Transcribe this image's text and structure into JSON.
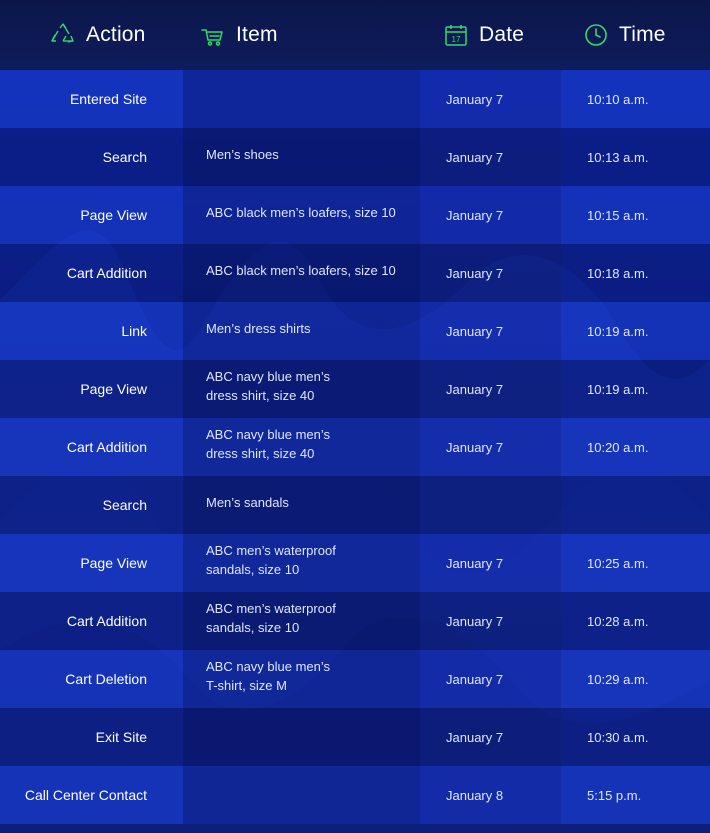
{
  "header": {
    "action_label": "Action",
    "item_label": "Item",
    "date_label": "Date",
    "time_label": "Time",
    "calendar_icon_day": "17",
    "icon_color": "#32d96a"
  },
  "rows": [
    {
      "action": "Entered Site",
      "item": "",
      "date": "January 7",
      "time": "10:10 a.m."
    },
    {
      "action": "Search",
      "item": "Men’s shoes",
      "date": "January 7",
      "time": "10:13 a.m."
    },
    {
      "action": "Page View",
      "item": "ABC black men’s loafers, size 10",
      "date": "January 7",
      "time": "10:15 a.m."
    },
    {
      "action": "Cart Addition",
      "item": "ABC black men’s loafers, size 10",
      "date": "January 7",
      "time": "10:18 a.m."
    },
    {
      "action": "Link",
      "item": "Men’s dress shirts",
      "date": "January 7",
      "time": "10:19 a.m."
    },
    {
      "action": "Page View",
      "item": "ABC navy blue men’s\ndress shirt, size 40",
      "date": "January 7",
      "time": "10:19 a.m."
    },
    {
      "action": "Cart Addition",
      "item": "ABC navy blue men’s\ndress shirt, size 40",
      "date": "January 7",
      "time": "10:20 a.m."
    },
    {
      "action": "Search",
      "item": "Men’s sandals",
      "date": "",
      "time": ""
    },
    {
      "action": "Page View",
      "item": "ABC men’s waterproof\nsandals, size 10",
      "date": "January 7",
      "time": "10:25 a.m."
    },
    {
      "action": "Cart Addition",
      "item": "ABC men’s waterproof\nsandals, size 10",
      "date": "January 7",
      "time": "10:28 a.m."
    },
    {
      "action": "Cart Deletion",
      "item": "ABC navy blue men’s\nT-shirt, size M",
      "date": "January 7",
      "time": "10:29 a.m."
    },
    {
      "action": "Exit Site",
      "item": "",
      "date": "January 7",
      "time": "10:30 a.m."
    },
    {
      "action": "Call Center Contact",
      "item": "",
      "date": "January 8",
      "time": "5:15 p.m."
    }
  ]
}
